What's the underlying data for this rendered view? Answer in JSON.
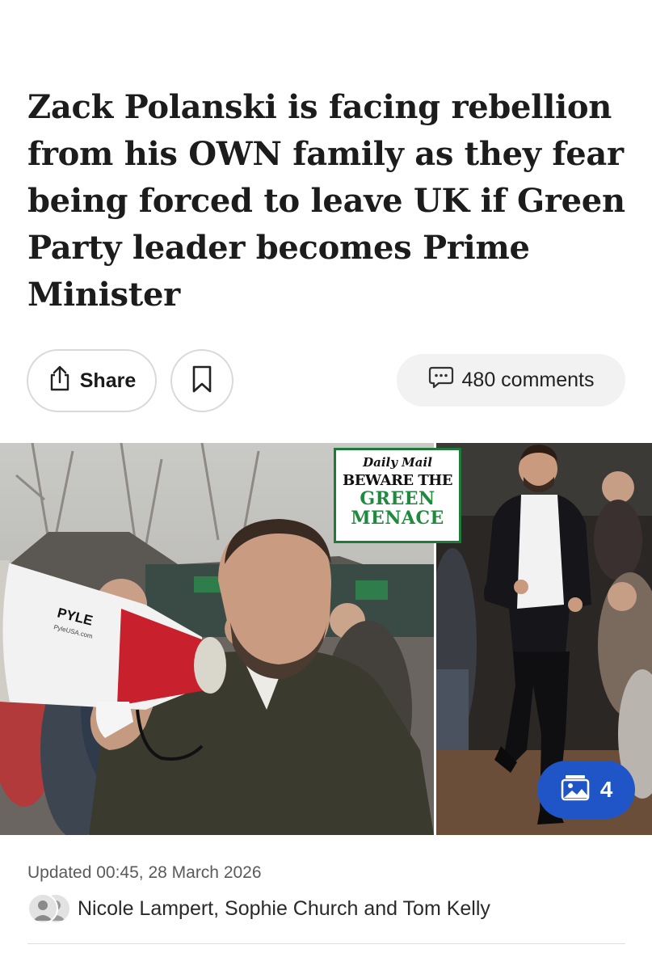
{
  "article": {
    "headline": "Zack Polanski is facing rebellion from his OWN family as they fear being forced to leave UK if Green Party leader becomes Prime Minister",
    "updated": "Updated 00:45, 28 March 2026",
    "authors": "Nicole Lampert, Sophie Church and Tom Kelly"
  },
  "actions": {
    "share_label": "Share",
    "share_icon": "share-icon",
    "bookmark_icon": "bookmark-icon",
    "comments_label": "480 comments",
    "comments_icon": "comment-bubble-icon"
  },
  "hero": {
    "badge_brand": "Daily Mail",
    "badge_line1": "BEWARE THE",
    "badge_line2": "GREEN",
    "badge_line3": "MENACE",
    "megaphone_brand": "PYLE",
    "megaphone_url": "PyleUSA.com",
    "gallery_count": "4",
    "gallery_icon": "image-gallery-icon"
  },
  "colors": {
    "accent_blue": "#1f55c6",
    "badge_green": "#1f8a3e",
    "megaphone_red": "#c8202c"
  }
}
